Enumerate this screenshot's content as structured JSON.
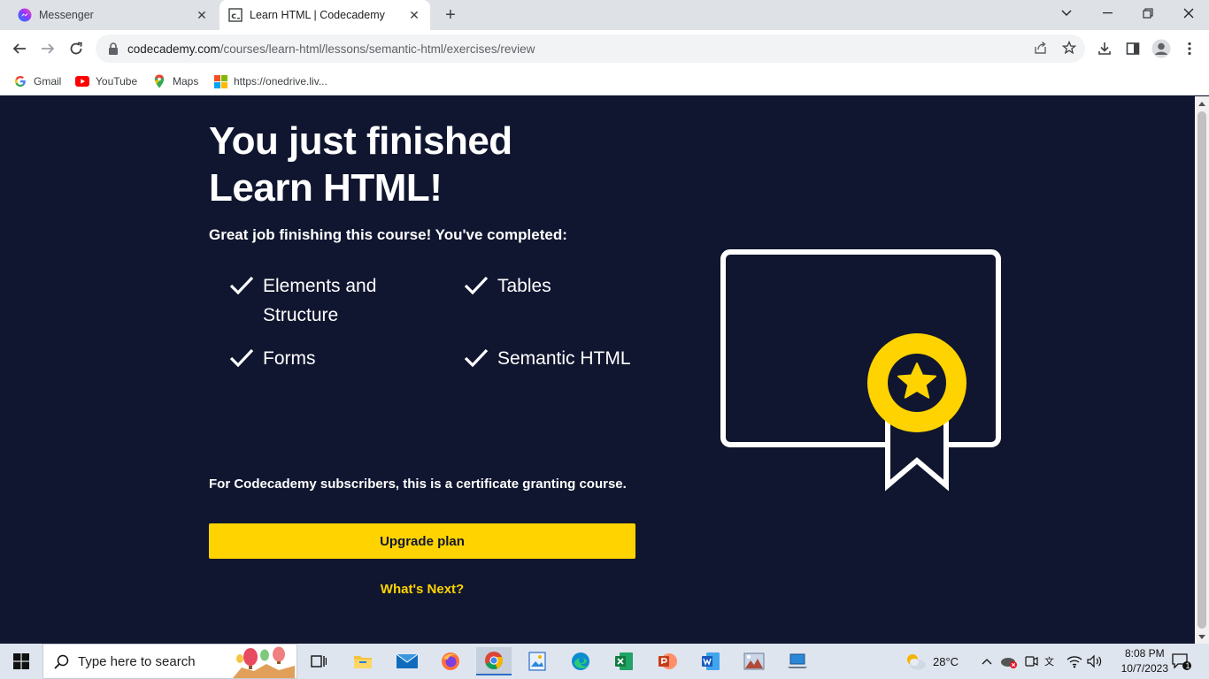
{
  "browser": {
    "tabs": [
      {
        "title": "Messenger",
        "icon": "messenger-icon",
        "active": false
      },
      {
        "title": "Learn HTML | Codecademy",
        "icon": "codecademy-icon",
        "active": true
      }
    ],
    "url_domain": "codecademy.com",
    "url_path": "/courses/learn-html/lessons/semantic-html/exercises/review",
    "bookmarks": [
      {
        "label": "Gmail",
        "icon": "google-icon"
      },
      {
        "label": "YouTube",
        "icon": "youtube-icon"
      },
      {
        "label": "Maps",
        "icon": "maps-icon"
      },
      {
        "label": "https://onedrive.liv...",
        "icon": "microsoft-icon"
      }
    ]
  },
  "page": {
    "heading_line1": "You just finished",
    "heading_line2": "Learn HTML!",
    "intro": "Great job finishing this course! You've completed:",
    "lessons": [
      {
        "label": "Elements and Structure"
      },
      {
        "label": "Tables"
      },
      {
        "label": "Forms"
      },
      {
        "label": "Semantic HTML"
      }
    ],
    "note": "For Codecademy subscribers, this is a certificate granting course.",
    "upgrade_label": "Upgrade plan",
    "next_label": "What's Next?",
    "colors": {
      "background": "#10162f",
      "accent": "#ffd300",
      "text": "#ffffff"
    }
  },
  "taskbar": {
    "search_placeholder": "Type here to search",
    "weather": "28°C",
    "time": "8:08 PM",
    "date": "10/7/2023",
    "notification_count": "1",
    "apps": [
      "task-view-icon",
      "file-explorer-icon",
      "mail-icon",
      "firefox-icon",
      "chrome-icon",
      "photos-icon",
      "edge-icon",
      "excel-icon",
      "powerpoint-icon",
      "word-icon",
      "image-viewer-icon",
      "laptop-icon"
    ]
  }
}
